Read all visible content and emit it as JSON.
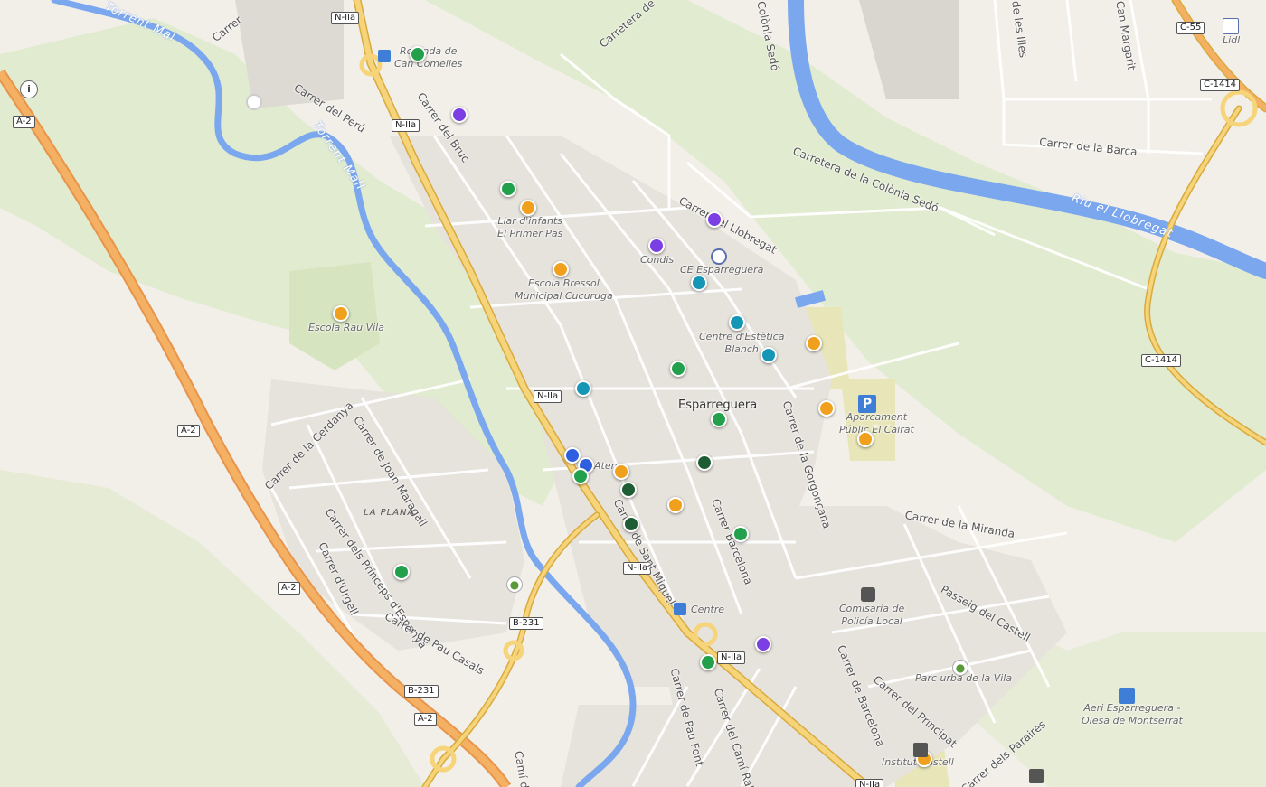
{
  "colors": {
    "purple": "#7b3fe4",
    "green": "#22a04b",
    "darkgreen": "#1e5c34",
    "orange": "#f0a01c",
    "teal": "#1596b4",
    "blue": "#2f5fe0",
    "water": "#7ba7ee",
    "road_major": "#f3c65d",
    "road_motorway": "#f0a848",
    "park": "#dfeacc",
    "background": "#f2efe9"
  },
  "labels": {
    "town": "Esparreguera",
    "river_llobregat": "Riu el Llobregat",
    "torrent_1": "Torrent Mal",
    "torrent_2": "Torrent Mall",
    "la_plana": "LA PLANA"
  },
  "streets": [
    {
      "text": "Carrer del Perú"
    },
    {
      "text": "Carrer del Bruc"
    },
    {
      "text": "Carretera de"
    },
    {
      "text": "Carrer"
    },
    {
      "text": "Carrer del Llobregat"
    },
    {
      "text": "Carretera de la Colònia Sedó"
    },
    {
      "text": "Colònia Sedó"
    },
    {
      "text": "de les Illes"
    },
    {
      "text": "Can Margarit"
    },
    {
      "text": "Carrer de la Barca"
    },
    {
      "text": "Carrer de la Cerdanya"
    },
    {
      "text": "Carrer de Joan Maragall"
    },
    {
      "text": "Carrer dels Prínceps d'Espanya"
    },
    {
      "text": "Carrer d'Urgell"
    },
    {
      "text": "Carrer de Pau Casals"
    },
    {
      "text": "Carrer de Sant Miquel"
    },
    {
      "text": "Carrer Barcelona"
    },
    {
      "text": "Carrer de la Gorgonçana"
    },
    {
      "text": "Carrer de la Miranda"
    },
    {
      "text": "Passeig del Castell"
    },
    {
      "text": "Carrer de Barcelona"
    },
    {
      "text": "Carrer del Principat"
    },
    {
      "text": "Carrer dels Paraires"
    },
    {
      "text": "Carrer del Camí Ral"
    },
    {
      "text": "Carrer de Pau Font"
    },
    {
      "text": "Camí d"
    }
  ],
  "shields": [
    {
      "text": "N-IIa"
    },
    {
      "text": "N-IIa"
    },
    {
      "text": "N-IIa"
    },
    {
      "text": "N-IIa"
    },
    {
      "text": "N-IIa"
    },
    {
      "text": "N-IIa"
    },
    {
      "text": "A-2"
    },
    {
      "text": "A-2"
    },
    {
      "text": "A-2"
    },
    {
      "text": "A-2"
    },
    {
      "text": "B-231"
    },
    {
      "text": "B-231"
    },
    {
      "text": "C-55"
    },
    {
      "text": "C-1414"
    },
    {
      "text": "C-1414"
    }
  ],
  "pois": [
    {
      "text": "Rotonda de\nCan Comelles"
    },
    {
      "text": "Llar d'infants\nEl Primer Pas"
    },
    {
      "text": "Condis"
    },
    {
      "text": "CE Esparreguera"
    },
    {
      "text": "Escola Bressol\nMunicipal Cucuruga"
    },
    {
      "text": "Escola Rau Vila"
    },
    {
      "text": "Centre d'Estètica\nBlanch"
    },
    {
      "text": "Aparcament\nPúblic El Cairat"
    },
    {
      "text": "Aten"
    },
    {
      "text": "Centre"
    },
    {
      "text": "Comisaría de\nPolicía Local"
    },
    {
      "text": "Parc urbà de la Vila"
    },
    {
      "text": "Aeri Esparreguera -\nOlesa de Montserrat"
    },
    {
      "text": "Institut Castell"
    },
    {
      "text": "Lidl"
    }
  ],
  "markers": [
    {
      "color": "green",
      "label": "marker-1"
    },
    {
      "color": "purple",
      "label": "marker-2"
    },
    {
      "color": "green",
      "label": "marker-3"
    },
    {
      "color": "orange",
      "label": "marker-4"
    },
    {
      "color": "purple",
      "label": "marker-5"
    },
    {
      "color": "purple",
      "label": "marker-6"
    },
    {
      "color": "orange",
      "label": "marker-7"
    },
    {
      "color": "teal",
      "label": "marker-8"
    },
    {
      "color": "orange",
      "label": "marker-9"
    },
    {
      "color": "teal",
      "label": "marker-10"
    },
    {
      "color": "teal",
      "label": "marker-11"
    },
    {
      "color": "orange",
      "label": "marker-12"
    },
    {
      "color": "green",
      "label": "marker-13"
    },
    {
      "color": "teal",
      "label": "marker-14"
    },
    {
      "color": "orange",
      "label": "marker-15"
    },
    {
      "color": "green",
      "label": "marker-16"
    },
    {
      "color": "orange",
      "label": "marker-17"
    },
    {
      "color": "blue",
      "label": "marker-18"
    },
    {
      "color": "blue",
      "label": "marker-19"
    },
    {
      "color": "green",
      "label": "marker-20"
    },
    {
      "color": "orange",
      "label": "marker-21"
    },
    {
      "color": "darkgreen",
      "label": "marker-22"
    },
    {
      "color": "darkgreen",
      "label": "marker-23"
    },
    {
      "color": "orange",
      "label": "marker-24"
    },
    {
      "color": "darkgreen",
      "label": "marker-25"
    },
    {
      "color": "green",
      "label": "marker-26"
    },
    {
      "color": "green",
      "label": "marker-27"
    },
    {
      "color": "purple",
      "label": "marker-28"
    },
    {
      "color": "green",
      "label": "marker-29"
    },
    {
      "color": "orange",
      "label": "marker-30"
    }
  ],
  "icons": {
    "info": "i",
    "parking": "P"
  }
}
